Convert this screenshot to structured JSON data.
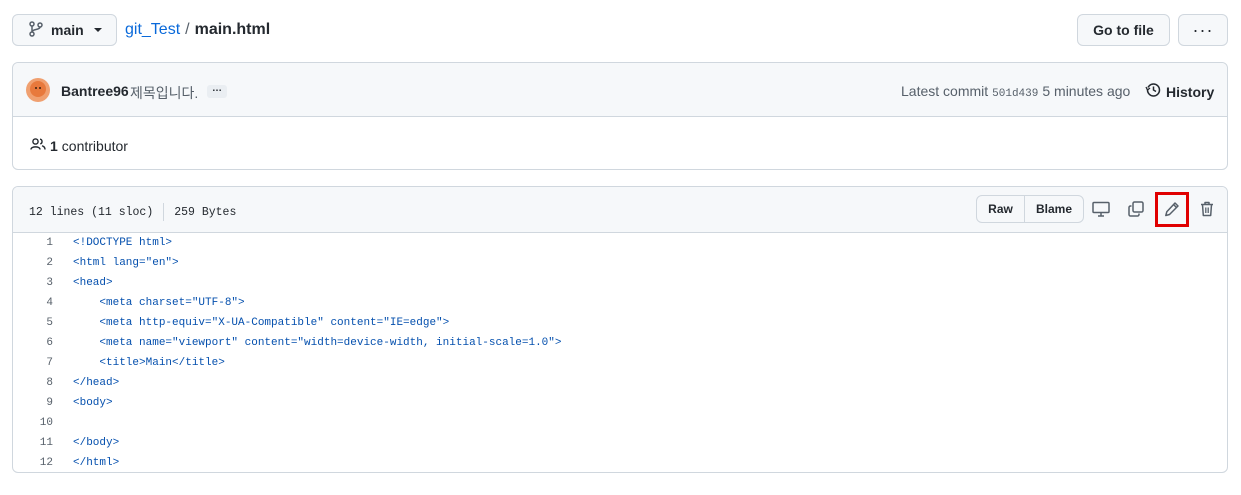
{
  "branch": {
    "label": "main"
  },
  "breadcrumb": {
    "repo": "git_Test",
    "separator": "/",
    "file": "main.html"
  },
  "toolbar": {
    "go_to_file": "Go to file",
    "more": "···"
  },
  "commit": {
    "author": "Bantree96",
    "message": "제목입니다.",
    "ellipsis": "…",
    "latest_label": "Latest commit",
    "sha": "501d439",
    "time": "5 minutes ago",
    "history_label": "History"
  },
  "contributors": {
    "count": "1",
    "label": "contributor"
  },
  "file": {
    "lines_info": "12 lines (11 sloc)",
    "size": "259 Bytes",
    "raw_label": "Raw",
    "blame_label": "Blame"
  },
  "icons": {
    "branch": "git-branch-icon",
    "history": "history-icon",
    "people": "people-icon",
    "display": "desktop-icon",
    "copy": "copy-icon",
    "edit": "pencil-icon",
    "delete": "trash-icon"
  },
  "colors": {
    "link": "#0969da",
    "code": "#0550ae",
    "highlight": "#e00000"
  },
  "code_lines": [
    {
      "num": "1",
      "text": "<!DOCTYPE html>"
    },
    {
      "num": "2",
      "text": "<html lang=\"en\">"
    },
    {
      "num": "3",
      "text": "<head>"
    },
    {
      "num": "4",
      "text": "    <meta charset=\"UTF-8\">"
    },
    {
      "num": "5",
      "text": "    <meta http-equiv=\"X-UA-Compatible\" content=\"IE=edge\">"
    },
    {
      "num": "6",
      "text": "    <meta name=\"viewport\" content=\"width=device-width, initial-scale=1.0\">"
    },
    {
      "num": "7",
      "text": "    <title>Main</title>"
    },
    {
      "num": "8",
      "text": "</head>"
    },
    {
      "num": "9",
      "text": "<body>"
    },
    {
      "num": "10",
      "text": ""
    },
    {
      "num": "11",
      "text": "</body>"
    },
    {
      "num": "12",
      "text": "</html>"
    }
  ]
}
